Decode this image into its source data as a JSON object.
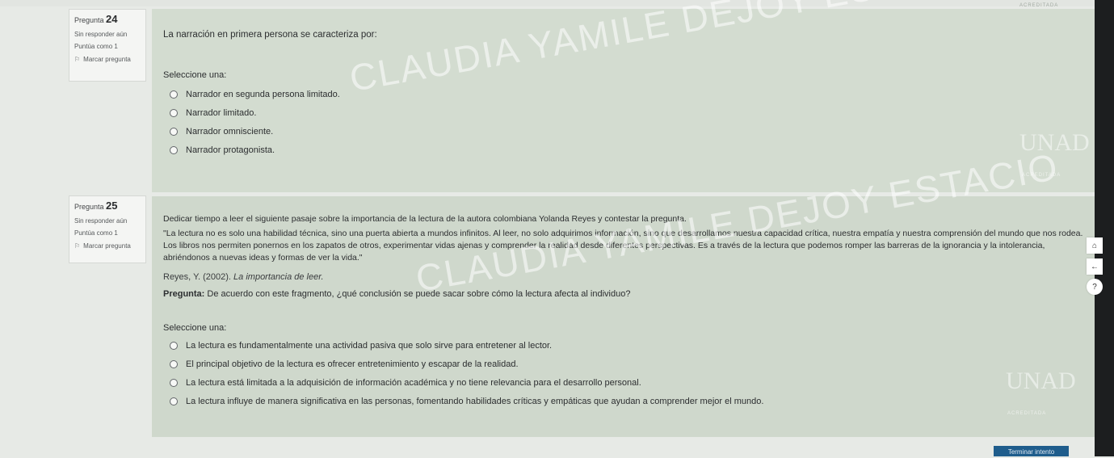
{
  "questions": [
    {
      "number_label": "Pregunta",
      "number": "24",
      "status": "Sin responder aún",
      "score": "Puntúa como 1",
      "flag_label": "Marcar pregunta",
      "text": "La narración en primera persona se caracteriza por:",
      "select_label": "Seleccione una:",
      "options": [
        "Narrador en segunda persona limitado.",
        "Narrador limitado.",
        "Narrador omnisciente.",
        "Narrador protagonista."
      ]
    },
    {
      "number_label": "Pregunta",
      "number": "25",
      "status": "Sin responder aún",
      "score": "Puntúa como 1",
      "flag_label": "Marcar pregunta",
      "text": "Dedicar tiempo a leer el siguiente pasaje sobre la importancia de la lectura de la autora colombiana Yolanda Reyes y contestar la pregunta.",
      "passage": "\"La lectura no es solo una habilidad técnica, sino una puerta abierta a mundos infinitos. Al leer, no solo adquirimos información, sino que desarrollamos nuestra capacidad crítica, nuestra empatía y nuestra comprensión del mundo que nos rodea. Los libros nos permiten ponernos en los zapatos de otros, experimentar vidas ajenas y comprender la realidad desde diferentes perspectivas. Es a través de la lectura que podemos romper las barreras de la ignorancia y la intolerancia, abriéndonos a nuevas ideas y formas de ver la vida.\"",
      "citation_author": "Reyes, Y. (2002).",
      "citation_title": "La importancia de leer.",
      "prompt_label": "Pregunta:",
      "prompt_text": "De acuerdo con este fragmento, ¿qué conclusión se puede sacar sobre cómo la lectura afecta al individuo?",
      "select_label": "Seleccione una:",
      "options": [
        "La lectura es fundamentalmente una actividad pasiva que solo sirve para entretener al lector.",
        "El principal objetivo de la lectura es ofrecer entretenimiento y escapar de la realidad.",
        "La lectura está limitada a la adquisición de información académica y no tiene relevancia para el desarrollo personal.",
        "La lectura influye de manera significativa en las personas, fomentando habilidades críticas y empáticas que ayudan a comprender mejor el mundo."
      ]
    }
  ],
  "watermark": {
    "name": "CLAUDIA YAMILE DEJOY ESTACIO",
    "logo": "UNAD",
    "badge": "ACREDITADA"
  },
  "sidebar_icons": [
    "home-icon",
    "back-arrow-icon",
    "help-icon"
  ],
  "finish_button": "Terminar intento",
  "colors": {
    "panel": "#cfd8cc",
    "info_box": "#f4f5f3",
    "background": "#e7eae6",
    "finish_button": "#1f5d8c"
  }
}
